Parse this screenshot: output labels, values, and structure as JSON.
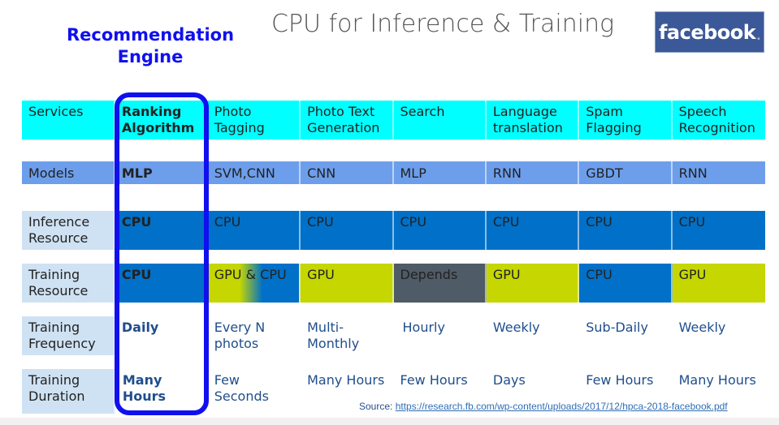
{
  "header": {
    "callout": [
      "Recommendation",
      "Engine"
    ],
    "title": "CPU for Inference & Training",
    "logo": {
      "text": "facebook",
      "dot": ".",
      "color": "#3b5998"
    }
  },
  "colors": {
    "services_row": "#00ffff",
    "models_row": "#6d9eeb",
    "cpu": "#0070c8",
    "gpu": "#c5d600",
    "depends": "#4f5b66",
    "row_label_bg": "#cfe2f3",
    "highlight": "#1010ee"
  },
  "table": {
    "services": {
      "label": "Services",
      "values": [
        "Ranking Algorithm",
        "Photo Tagging",
        "Photo Text Generation",
        "Search",
        "Language translation",
        "Spam Flagging",
        "Speech Recognition"
      ]
    },
    "models": {
      "label": "Models",
      "values": [
        "MLP",
        "SVM,CNN",
        "CNN",
        "MLP",
        "RNN",
        "GBDT",
        "RNN"
      ]
    },
    "inference": {
      "label": "Inference Resource",
      "values": [
        "CPU",
        "CPU",
        "CPU",
        "CPU",
        "CPU",
        "CPU",
        "CPU"
      ]
    },
    "training": {
      "label": "Training Resource",
      "values": [
        "CPU",
        "GPU & CPU",
        "GPU",
        "Depends",
        "GPU",
        "CPU",
        "GPU"
      ]
    },
    "frequency": {
      "label": "Training Frequency",
      "values": [
        "Daily",
        "Every N photos",
        "Multi-Monthly",
        "Hourly",
        "Weekly",
        "Sub-Daily",
        "Weekly"
      ]
    },
    "duration": {
      "label": "Training Duration",
      "values": [
        "Many Hours",
        "Few Seconds",
        "Many Hours",
        "Few Hours",
        "Days",
        "Few Hours",
        "Many Hours"
      ]
    }
  },
  "source": {
    "label": "Source:",
    "link": "https://research.fb.com/wp-content/uploads/2017/12/hpca-2018-facebook.pdf"
  }
}
